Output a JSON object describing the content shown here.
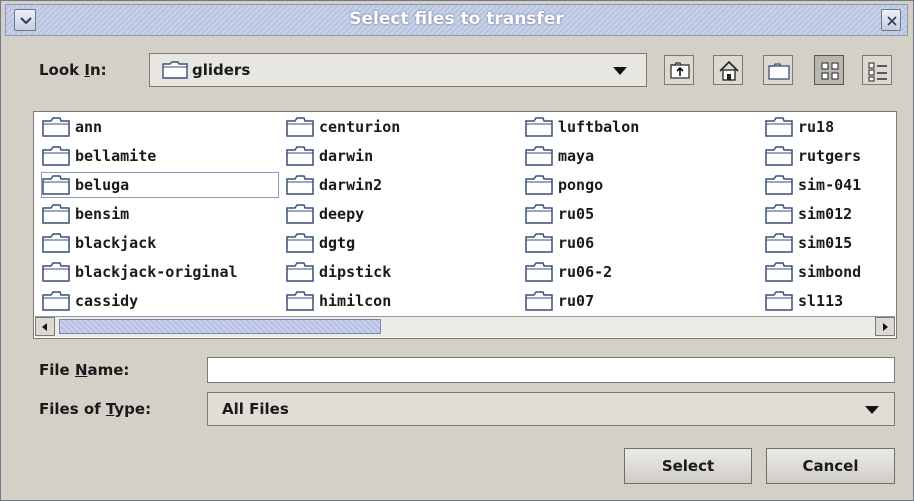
{
  "window": {
    "title": "Select files to transfer"
  },
  "look_in": {
    "label_prefix": "Look ",
    "label_mnemonic": "I",
    "label_suffix": "n:",
    "value": "gliders"
  },
  "files": [
    [
      "ann",
      "bellamite",
      "beluga",
      "bensim",
      "blackjack",
      "blackjack-original",
      "cassidy"
    ],
    [
      "centurion",
      "darwin",
      "darwin2",
      "deepy",
      "dgtg",
      "dipstick",
      "himilcon"
    ],
    [
      "luftbalon",
      "maya",
      "pongo",
      "ru05",
      "ru06",
      "ru06-2",
      "ru07"
    ],
    [
      "ru18",
      "rutgers",
      "sim-041",
      "sim012",
      "sim015",
      "simbond",
      "sl113"
    ]
  ],
  "file_name": {
    "label_prefix": "File ",
    "label_mnemonic": "N",
    "label_suffix": "ame:",
    "value": ""
  },
  "file_type": {
    "label_prefix": "Files of ",
    "label_mnemonic": "T",
    "label_suffix": "ype:",
    "value": "All Files"
  },
  "buttons": {
    "select": "Select",
    "cancel": "Cancel"
  },
  "icons": {
    "menu": "chevron-down-icon",
    "close": "close-icon",
    "up": "up-folder-icon",
    "home": "home-icon",
    "new_folder": "new-folder-icon",
    "list": "list-view-icon",
    "details": "details-view-icon"
  },
  "colors": {
    "title_bar": "#b7c3df",
    "dialog_bg": "#d4d0c8",
    "scroll_thumb": "#b6c0e0"
  }
}
